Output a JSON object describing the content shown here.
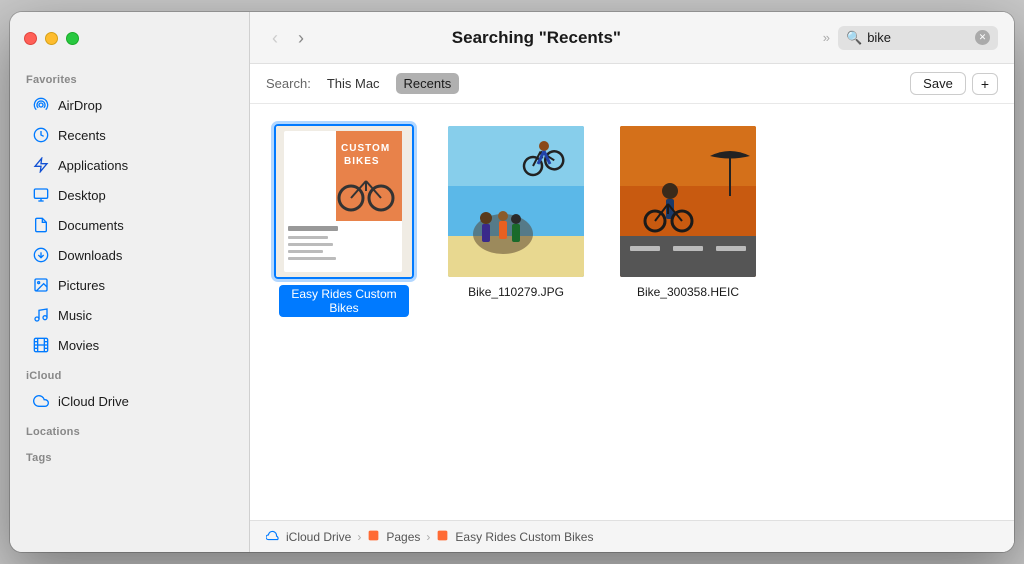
{
  "window": {
    "title": "Searching \"Recents\""
  },
  "sidebar": {
    "sections": [
      {
        "label": "Favorites",
        "items": [
          {
            "id": "airdrop",
            "label": "AirDrop",
            "icon": "📡",
            "iconType": "airdrop"
          },
          {
            "id": "recents",
            "label": "Recents",
            "icon": "🕐",
            "iconType": "recents"
          },
          {
            "id": "applications",
            "label": "Applications",
            "icon": "🚀",
            "iconType": "applications"
          },
          {
            "id": "desktop",
            "label": "Desktop",
            "icon": "🖥",
            "iconType": "desktop"
          },
          {
            "id": "documents",
            "label": "Documents",
            "icon": "📄",
            "iconType": "documents"
          },
          {
            "id": "downloads",
            "label": "Downloads",
            "icon": "⬇",
            "iconType": "downloads"
          },
          {
            "id": "pictures",
            "label": "Pictures",
            "icon": "🖼",
            "iconType": "pictures"
          },
          {
            "id": "music",
            "label": "Music",
            "icon": "🎵",
            "iconType": "music"
          },
          {
            "id": "movies",
            "label": "Movies",
            "icon": "📺",
            "iconType": "movies"
          }
        ]
      },
      {
        "label": "iCloud",
        "items": [
          {
            "id": "icloud-drive",
            "label": "iCloud Drive",
            "icon": "☁",
            "iconType": "icloud"
          }
        ]
      },
      {
        "label": "Locations",
        "items": []
      },
      {
        "label": "Tags",
        "items": []
      }
    ]
  },
  "toolbar": {
    "back_label": "‹",
    "forward_label": "›",
    "title": "Searching \"Recents\"",
    "chevron_dbl": "»",
    "search_value": "bike",
    "search_placeholder": "Search"
  },
  "search_bar": {
    "label": "Search:",
    "options": [
      {
        "id": "this-mac",
        "label": "This Mac",
        "active": false
      },
      {
        "id": "recents",
        "label": "Recents",
        "active": true
      }
    ],
    "save_label": "Save",
    "plus_label": "+"
  },
  "files": [
    {
      "id": "file-1",
      "name": "Easy Rides Custom Bikes",
      "type": "magazine",
      "selected": true
    },
    {
      "id": "file-2",
      "name": "Bike_110279.JPG",
      "type": "bike-air",
      "selected": false
    },
    {
      "id": "file-3",
      "name": "Bike_300358.HEIC",
      "type": "bike-orange",
      "selected": false
    }
  ],
  "status_bar": {
    "path": [
      {
        "id": "icloud",
        "label": "iCloud Drive",
        "icon": "cloud"
      },
      {
        "id": "pages",
        "label": "Pages",
        "icon": "pages"
      },
      {
        "id": "file",
        "label": "Easy Rides Custom Bikes",
        "icon": "pages"
      }
    ],
    "separator": "›"
  }
}
